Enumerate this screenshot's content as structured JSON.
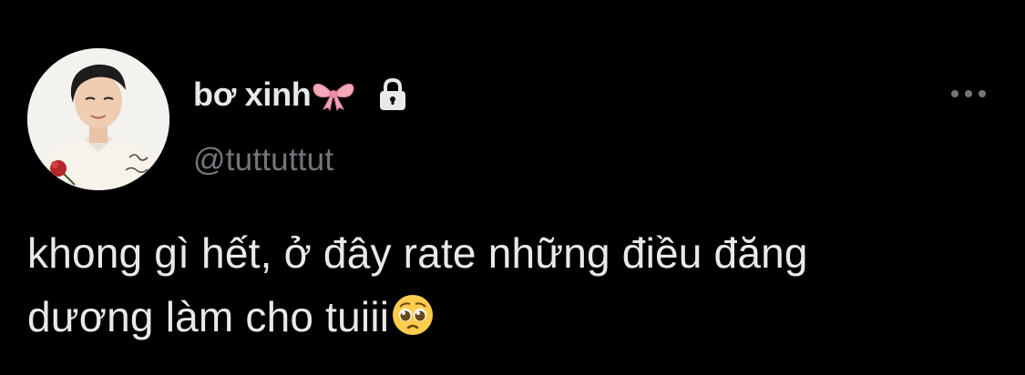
{
  "tweet": {
    "author": {
      "display_name": "bơ xinh",
      "name_emoji": "ribbon-bow-icon",
      "protected_icon": "lock-icon",
      "handle": "@tuttuttut"
    },
    "more_icon": "more-horizontal-icon",
    "text_lines": [
      "khong gì hết, ở đây rate những điều đăng",
      "dương làm cho tuiii"
    ],
    "text_emoji": "pleading-face-icon"
  },
  "colors": {
    "background": "#000000",
    "primary_text": "#e7e9ea",
    "secondary_text": "#71767b",
    "bow_pink": "#f4a7b9"
  }
}
